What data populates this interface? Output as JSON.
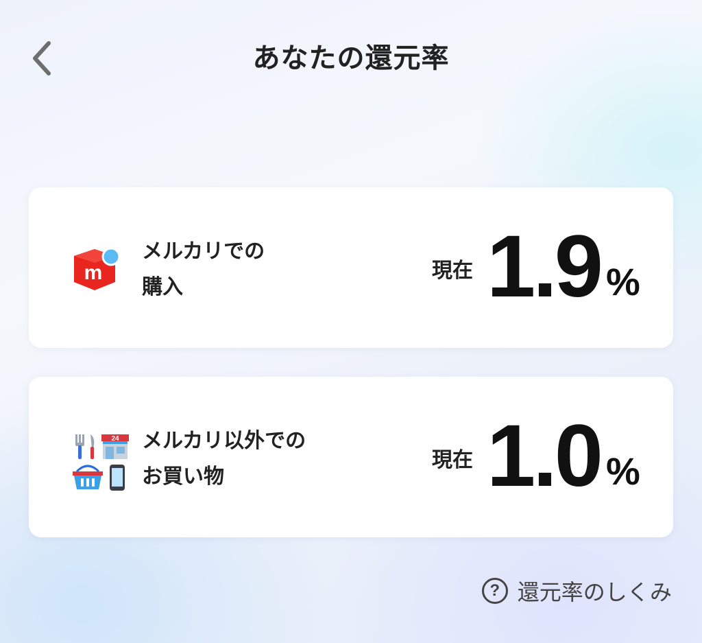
{
  "header": {
    "title": "あなたの還元率",
    "back_icon": "chevron-left-icon"
  },
  "cards": [
    {
      "icon": "mercari-logo-icon",
      "label_line1": "メルカリでの",
      "label_line2": "購入",
      "rate_prefix": "現在",
      "rate_value": "1.9",
      "rate_unit": "%"
    },
    {
      "icons": [
        "cutlery-icon",
        "convenience-store-icon",
        "shopping-basket-icon",
        "smartphone-icon"
      ],
      "label_line1": "メルカリ以外での",
      "label_line2": "お買い物",
      "rate_prefix": "現在",
      "rate_value": "1.0",
      "rate_unit": "%"
    }
  ],
  "help": {
    "icon_text": "?",
    "label": "還元率のしくみ"
  },
  "colors": {
    "mercari_red": "#e8251f",
    "badge_blue": "#5bbcf5",
    "text_dark": "#222222"
  }
}
